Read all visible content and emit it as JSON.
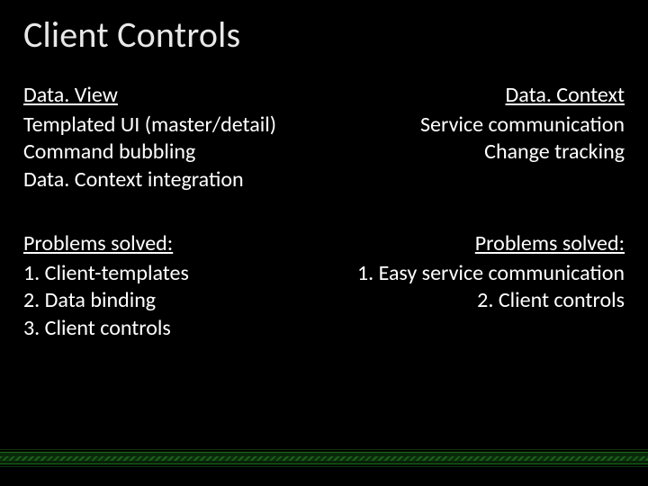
{
  "title": "Client Controls",
  "left": {
    "heading": "Data. View",
    "features": [
      "Templated UI (master/detail)",
      "Command bubbling",
      "Data. Context integration"
    ],
    "problems_heading": "Problems solved:",
    "problems": [
      "1. Client-templates",
      "2. Data binding",
      "3. Client controls"
    ]
  },
  "right": {
    "heading": "Data. Context",
    "features": [
      "Service communication",
      "Change tracking"
    ],
    "problems_heading": "Problems solved:",
    "problems": [
      "1. Easy service communication",
      "2. Client controls"
    ]
  }
}
